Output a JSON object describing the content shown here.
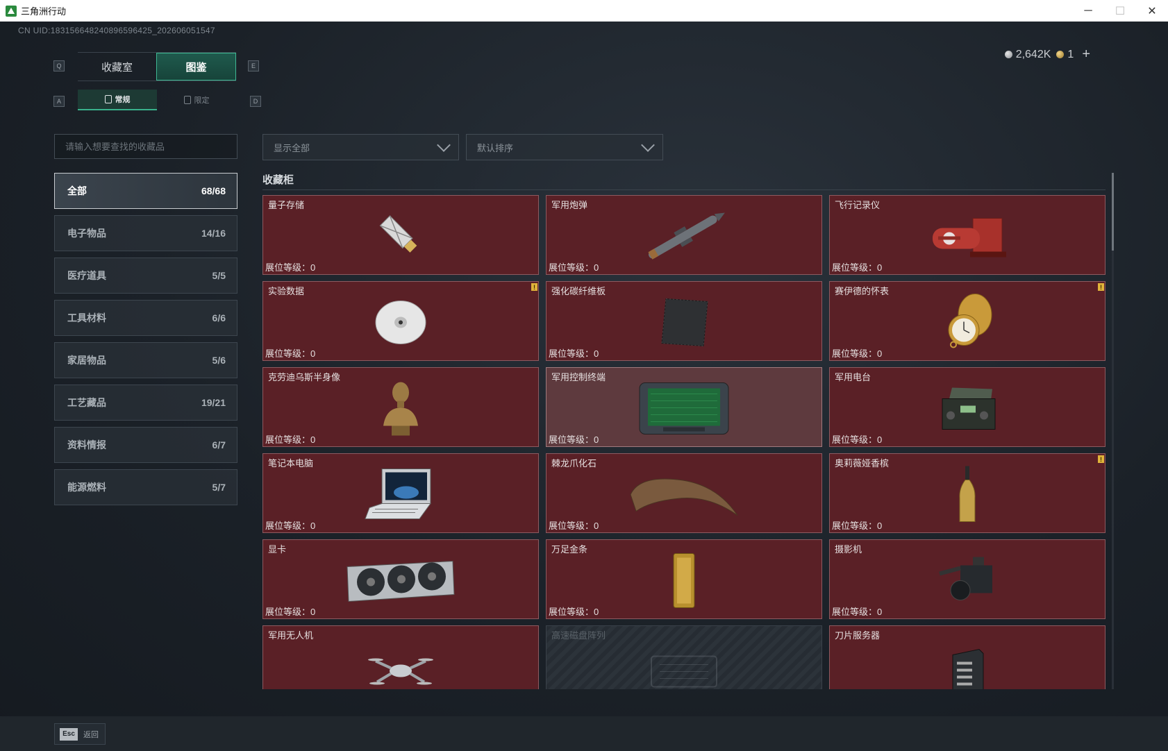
{
  "window": {
    "title": "三角洲行动",
    "minimize": "─",
    "maximize": "☐",
    "close": "✕"
  },
  "header": {
    "uid": "CN UID:183156648240896596425_202606051547",
    "currency": {
      "silver": "2,642K",
      "gold": "1",
      "add": "+"
    }
  },
  "keys": {
    "q": "Q",
    "e": "E",
    "a": "A",
    "d": "D"
  },
  "tabs": [
    {
      "label": "收藏室"
    },
    {
      "label": "图鉴"
    }
  ],
  "subtabs": [
    {
      "label": "常规"
    },
    {
      "label": "限定"
    }
  ],
  "search": {
    "placeholder": "请输入想要查找的收藏品"
  },
  "categories": [
    {
      "label": "全部",
      "count": "68/68"
    },
    {
      "label": "电子物品",
      "count": "14/16"
    },
    {
      "label": "医疗道具",
      "count": "5/5"
    },
    {
      "label": "工具材料",
      "count": "6/6"
    },
    {
      "label": "家居物品",
      "count": "5/6"
    },
    {
      "label": "工艺藏品",
      "count": "19/21"
    },
    {
      "label": "资料情报",
      "count": "6/7"
    },
    {
      "label": "能源燃料",
      "count": "5/7"
    }
  ],
  "filters": {
    "show": "显示全部",
    "sort": "默认排序"
  },
  "section": {
    "title": "收藏柜"
  },
  "items": [
    {
      "name": "量子存储",
      "level": "展位等级：0",
      "icon": "usb-drive-icon"
    },
    {
      "name": "军用炮弹",
      "level": "展位等级：0",
      "icon": "missile-icon"
    },
    {
      "name": "飞行记录仪",
      "level": "展位等级：0",
      "icon": "flight-recorder-icon"
    },
    {
      "name": "实验数据",
      "level": "展位等级：0",
      "icon": "disc-icon",
      "warn": "!"
    },
    {
      "name": "强化碳纤维板",
      "level": "展位等级：0",
      "icon": "carbon-plate-icon"
    },
    {
      "name": "赛伊德的怀表",
      "level": "展位等级：0",
      "icon": "pocket-watch-icon",
      "warn": "!"
    },
    {
      "name": "克劳迪乌斯半身像",
      "level": "展位等级：0",
      "icon": "bust-icon"
    },
    {
      "name": "军用控制终端",
      "level": "展位等级：0",
      "icon": "control-terminal-icon"
    },
    {
      "name": "军用电台",
      "level": "展位等级：0",
      "icon": "radio-icon"
    },
    {
      "name": "笔记本电脑",
      "level": "展位等级：0",
      "icon": "laptop-icon"
    },
    {
      "name": "棘龙爪化石",
      "level": "展位等级：0",
      "icon": "claw-fossil-icon"
    },
    {
      "name": "奥莉薇娅香槟",
      "level": "展位等级：0",
      "icon": "champagne-icon",
      "warn": "!"
    },
    {
      "name": "显卡",
      "level": "展位等级：0",
      "icon": "graphics-card-icon"
    },
    {
      "name": "万足金条",
      "level": "展位等级：0",
      "icon": "gold-bar-icon"
    },
    {
      "name": "摄影机",
      "level": "展位等级：0",
      "icon": "camera-icon"
    },
    {
      "name": "军用无人机",
      "level": "",
      "icon": "drone-icon"
    },
    {
      "name": "高速磁盘阵列",
      "level": "",
      "icon": "disk-array-icon"
    },
    {
      "name": "刀片服务器",
      "level": "",
      "icon": "blade-server-icon"
    }
  ],
  "footer": {
    "esc_key": "Esc",
    "back": "返回"
  },
  "colors": {
    "accent": "#39b28c",
    "card": "#5a2026",
    "warn": "#e0b33a"
  }
}
